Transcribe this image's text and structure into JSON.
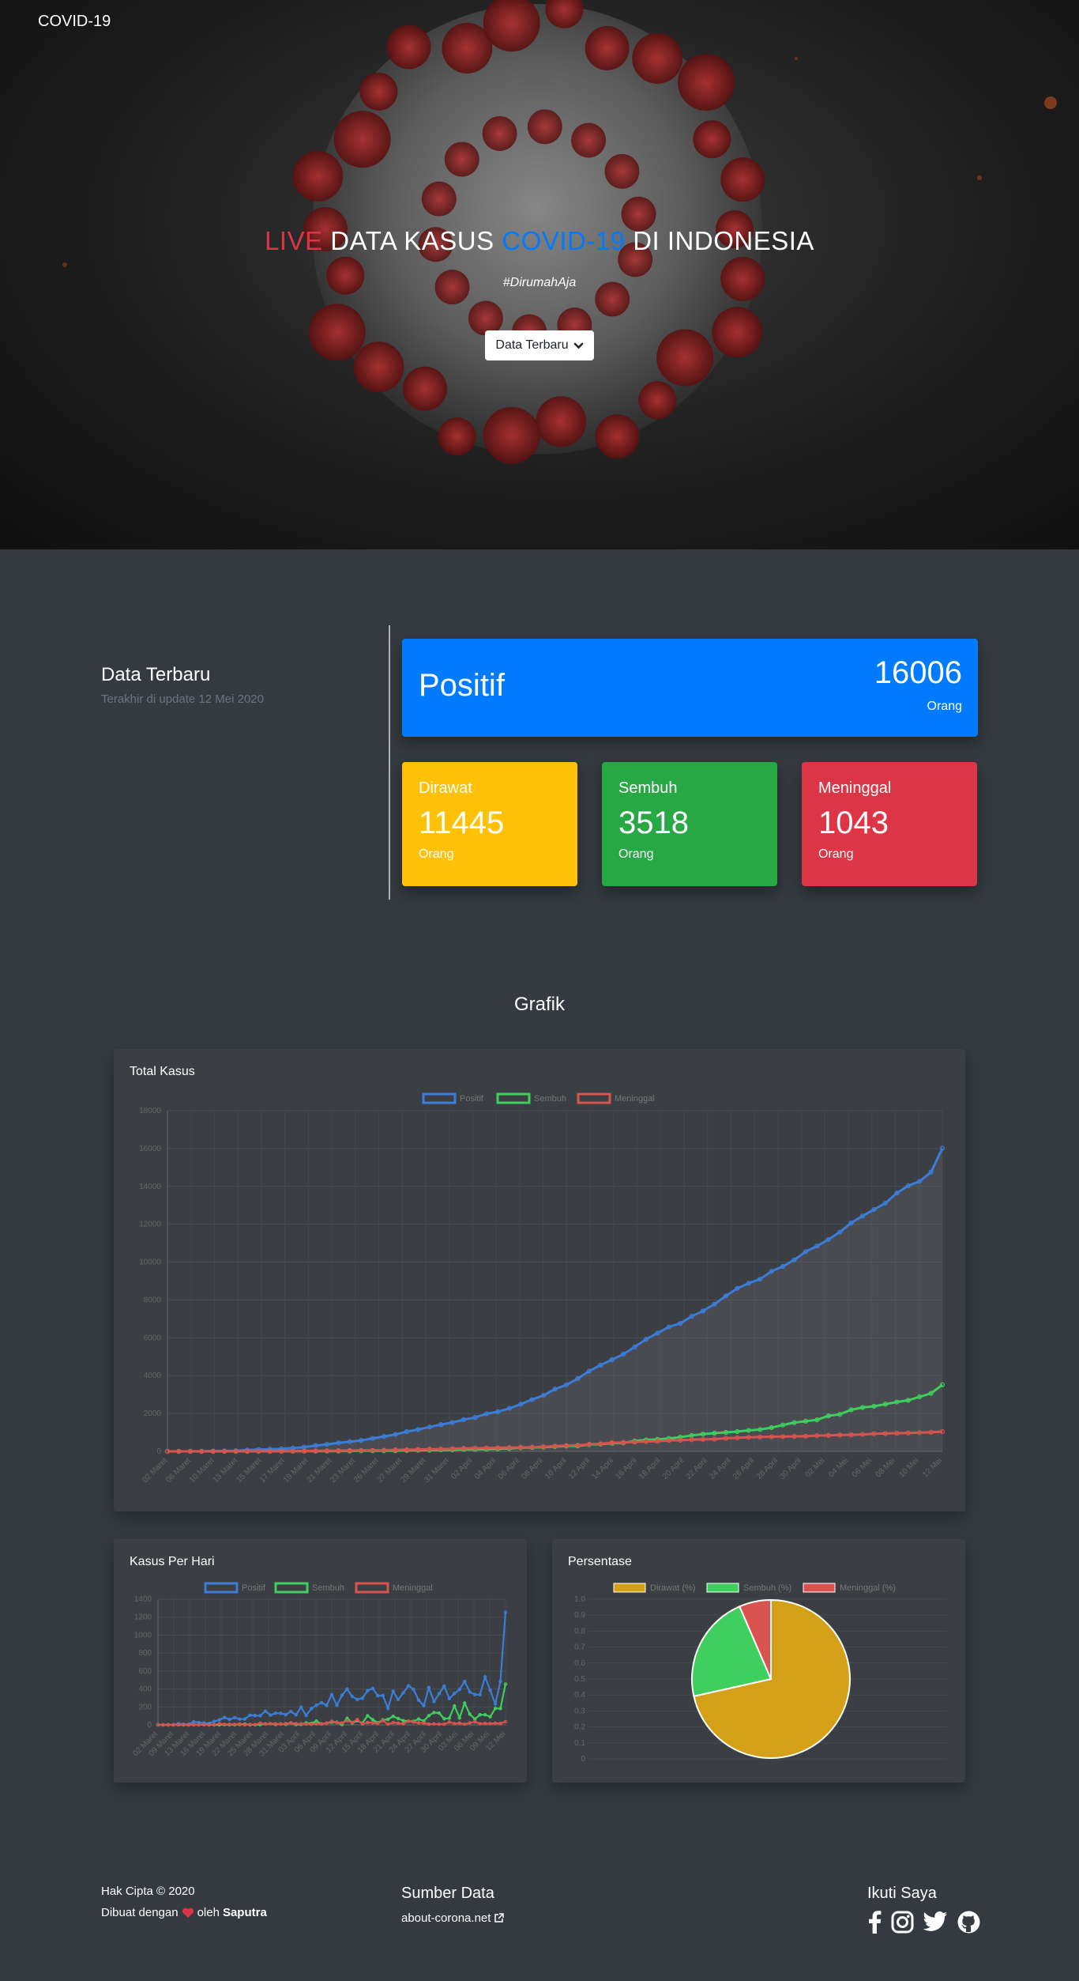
{
  "nav": {
    "brand": "COVID-19"
  },
  "hero": {
    "title_live": "LIVE",
    "title_mid": "DATA KASUS",
    "title_covid": "COVID-19",
    "title_end": "DI INDONESIA",
    "hashtag": "#DirumahAja",
    "button_label": "Data Terbaru"
  },
  "latest": {
    "heading": "Data Terbaru",
    "updated": "Terakhir di update 12 Mei 2020",
    "positif": {
      "label": "Positif",
      "value": "16006",
      "unit": "Orang"
    },
    "dirawat": {
      "label": "Dirawat",
      "value": "11445",
      "unit": "Orang"
    },
    "sembuh": {
      "label": "Sembuh",
      "value": "3518",
      "unit": "Orang"
    },
    "meninggal": {
      "label": "Meninggal",
      "value": "1043",
      "unit": "Orang"
    }
  },
  "grafik": {
    "heading": "Grafik"
  },
  "colors": {
    "positif": "#3b7dd8",
    "sembuh": "#3ecf5e",
    "meninggal": "#d9534f",
    "dirawat": "#d4a017"
  },
  "chart_data": [
    {
      "type": "line",
      "title": "Total Kasus",
      "ylim": [
        0,
        18000
      ],
      "yticks": [
        "0",
        "2000",
        "4000",
        "6000",
        "8000",
        "10000",
        "12000",
        "14000",
        "16000",
        "18000"
      ],
      "x_tick_labels": [
        "02 Maret",
        "06 Maret",
        "10 Maret",
        "13 Maret",
        "15 Maret",
        "17 Maret",
        "19 Maret",
        "21 Maret",
        "23 Maret",
        "26 Maret",
        "27 Maret",
        "29 Maret",
        "31 Maret",
        "02 April",
        "04 April",
        "06 April",
        "08 April",
        "10 April",
        "12 April",
        "14 April",
        "16 April",
        "18 April",
        "20 April",
        "22 April",
        "24 April",
        "26 April",
        "28 April",
        "30 April",
        "02 Mei",
        "04 Mei",
        "06 Mei",
        "08 Mei",
        "10 Mei",
        "12 Mei"
      ],
      "legend": [
        "Positif",
        "Sembuh",
        "Meninggal"
      ],
      "grid": true,
      "series": [
        {
          "name": "Positif",
          "values": [
            2,
            2,
            4,
            6,
            19,
            27,
            34,
            69,
            96,
            117,
            134,
            172,
            227,
            309,
            369,
            450,
            514,
            579,
            686,
            790,
            893,
            1046,
            1155,
            1285,
            1414,
            1528,
            1677,
            1790,
            1986,
            2092,
            2273,
            2491,
            2738,
            2956,
            3293,
            3512,
            3842,
            4241,
            4557,
            4839,
            5136,
            5516,
            5923,
            6248,
            6575,
            6760,
            7135,
            7418,
            7775,
            8211,
            8607,
            8882,
            9096,
            9511,
            9771,
            10118,
            10551,
            10843,
            11192,
            11587,
            12071,
            12438,
            12776,
            13112,
            13645,
            14032,
            14265,
            14749,
            16006
          ]
        },
        {
          "name": "Sembuh",
          "values": [
            0,
            0,
            0,
            0,
            0,
            0,
            0,
            2,
            3,
            5,
            8,
            8,
            9,
            11,
            13,
            15,
            20,
            29,
            30,
            31,
            35,
            46,
            59,
            64,
            75,
            81,
            103,
            107,
            112,
            134,
            150,
            192,
            202,
            222,
            252,
            282,
            286,
            359,
            380,
            426,
            446,
            548,
            607,
            631,
            686,
            747,
            842,
            913,
            960,
            1002,
            1042,
            1107,
            1151,
            1254,
            1391,
            1522,
            1591,
            1665,
            1876,
            1954,
            2197,
            2317,
            2381,
            2494,
            2607,
            2698,
            2881,
            3063,
            3518
          ]
        },
        {
          "name": "Meninggal",
          "values": [
            0,
            0,
            0,
            0,
            0,
            1,
            2,
            4,
            5,
            5,
            5,
            7,
            19,
            25,
            32,
            38,
            48,
            49,
            55,
            58,
            78,
            87,
            102,
            114,
            122,
            136,
            157,
            170,
            181,
            191,
            198,
            209,
            221,
            240,
            280,
            306,
            327,
            373,
            399,
            459,
            469,
            496,
            520,
            535,
            582,
            590,
            616,
            635,
            647,
            689,
            720,
            743,
            765,
            773,
            784,
            792,
            800,
            831,
            845,
            864,
            872,
            895,
            930,
            943,
            959,
            973,
            991,
            1007,
            1043
          ]
        }
      ]
    },
    {
      "type": "line",
      "title": "Kasus Per Hari",
      "ylim": [
        0,
        1400
      ],
      "yticks": [
        "0",
        "200",
        "400",
        "600",
        "800",
        "1000",
        "1200",
        "1400"
      ],
      "x_tick_labels": [
        "02 Maret",
        "09 Maret",
        "13 Maret",
        "16 Maret",
        "19 Maret",
        "22 Maret",
        "25 Maret",
        "28 Maret",
        "31 Maret",
        "03 April",
        "06 April",
        "09 April",
        "12 April",
        "15 April",
        "18 April",
        "21 April",
        "24 April",
        "27 April",
        "30 April",
        "03 Mei",
        "06 Mei",
        "09 Mei",
        "12 Mei"
      ],
      "legend": [
        "Positif",
        "Sembuh",
        "Meninggal"
      ],
      "grid": true,
      "series": [
        {
          "name": "Positif",
          "values": [
            2,
            0,
            2,
            2,
            13,
            8,
            7,
            35,
            27,
            21,
            17,
            38,
            55,
            82,
            60,
            81,
            64,
            65,
            107,
            104,
            103,
            153,
            109,
            130,
            129,
            114,
            149,
            113,
            196,
            106,
            181,
            218,
            247,
            218,
            337,
            219,
            330,
            399,
            316,
            282,
            297,
            380,
            407,
            325,
            327,
            185,
            375,
            283,
            357,
            436,
            396,
            275,
            214,
            415,
            260,
            347,
            433,
            292,
            349,
            395,
            484,
            367,
            338,
            336,
            533,
            387,
            233,
            484,
            1257
          ]
        },
        {
          "name": "Sembuh",
          "values": [
            0,
            0,
            0,
            0,
            0,
            0,
            0,
            2,
            1,
            2,
            3,
            0,
            1,
            2,
            2,
            2,
            5,
            9,
            1,
            1,
            4,
            11,
            13,
            5,
            11,
            6,
            22,
            4,
            5,
            22,
            16,
            42,
            10,
            20,
            30,
            30,
            4,
            73,
            21,
            46,
            20,
            102,
            59,
            24,
            55,
            61,
            95,
            71,
            47,
            42,
            40,
            65,
            44,
            103,
            137,
            131,
            69,
            74,
            211,
            78,
            243,
            120,
            64,
            113,
            113,
            91,
            183,
            182,
            455
          ]
        },
        {
          "name": "Meninggal",
          "values": [
            0,
            0,
            0,
            0,
            0,
            1,
            1,
            2,
            1,
            0,
            0,
            2,
            12,
            6,
            7,
            6,
            10,
            1,
            6,
            3,
            20,
            9,
            15,
            12,
            8,
            14,
            21,
            13,
            11,
            10,
            7,
            11,
            12,
            19,
            40,
            26,
            21,
            46,
            26,
            60,
            10,
            27,
            24,
            15,
            47,
            8,
            26,
            19,
            12,
            42,
            31,
            23,
            22,
            8,
            11,
            8,
            8,
            31,
            14,
            19,
            8,
            23,
            35,
            13,
            16,
            14,
            18,
            16,
            36
          ]
        }
      ]
    },
    {
      "type": "pie",
      "title": "Persentase",
      "categories": [
        "Dirawat (%)",
        "Sembuh (%)",
        "Meninggal (%)"
      ],
      "values": [
        71.5,
        22.0,
        6.5
      ],
      "yticks": [
        "0",
        "0.1",
        "0.2",
        "0.3",
        "0.4",
        "0.5",
        "0.6",
        "0.7",
        "0.8",
        "0.9",
        "1.0"
      ]
    }
  ],
  "footer": {
    "copyright": "Hak Cipta © 2020",
    "made_prefix": "Dibuat dengan",
    "made_mid": "oleh",
    "author": "Saputra",
    "source_heading": "Sumber Data",
    "source_link": "about-corona.net",
    "follow_heading": "Ikuti Saya"
  }
}
